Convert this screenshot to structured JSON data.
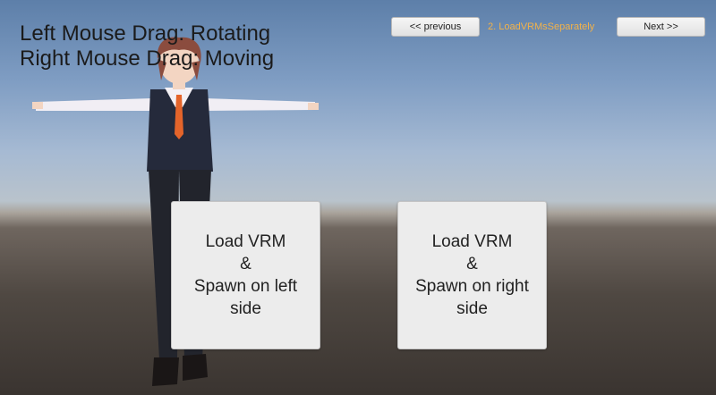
{
  "help": {
    "line1": "Left Mouse Drag: Rotating",
    "line2": "Right Mouse Drag: Moving"
  },
  "nav": {
    "previous_label": "<<  previous",
    "scene_name": "2. LoadVRMsSeparately",
    "next_label": "Next >>"
  },
  "buttons": {
    "left": {
      "line1": "Load VRM",
      "line2": "&",
      "line3": "Spawn on left side"
    },
    "right": {
      "line1": "Load VRM",
      "line2": "&",
      "line3": "Spawn on right side"
    }
  },
  "colors": {
    "sky": "#7f9dc3",
    "ground": "#4f4842",
    "scene_name": "#f2b24a"
  }
}
